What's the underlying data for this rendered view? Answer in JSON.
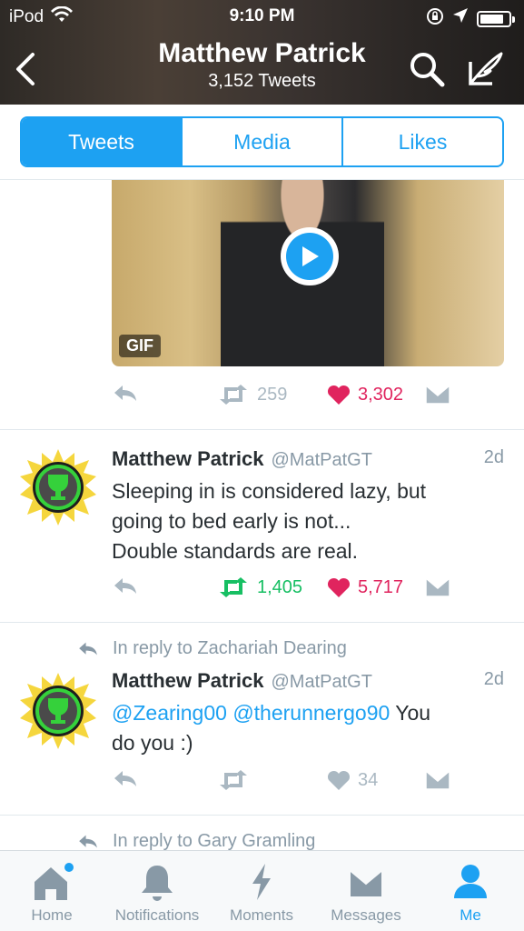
{
  "status": {
    "carrier": "iPod",
    "time": "9:10 PM"
  },
  "profile": {
    "name": "Matthew Patrick",
    "tweet_count": "3,152 Tweets"
  },
  "tabs": [
    {
      "label": "Tweets",
      "active": true
    },
    {
      "label": "Media",
      "active": false
    },
    {
      "label": "Likes",
      "active": false
    }
  ],
  "tweets": [
    {
      "media": {
        "badge": "GIF"
      },
      "retweets": "259",
      "likes": "3,302"
    },
    {
      "name": "Matthew Patrick",
      "handle": "@MatPatGT",
      "time": "2d",
      "text_lines": [
        "Sleeping in is considered lazy, but",
        "going to bed early is not...",
        "Double standards are real."
      ],
      "retweets": "1,405",
      "likes": "5,717"
    },
    {
      "reply_to": "In reply to Zachariah Dearing",
      "name": "Matthew Patrick",
      "handle": "@MatPatGT",
      "time": "2d",
      "mention1": "@Zearing00",
      "mention2": "@therunnergo90",
      "text_tail": "You",
      "text_line2": "do you :)",
      "retweets": "",
      "likes": "34"
    },
    {
      "reply_to": "In reply to Gary Gramling"
    }
  ],
  "tabbar": [
    {
      "label": "Home",
      "icon": "home-icon"
    },
    {
      "label": "Notifications",
      "icon": "bell-icon"
    },
    {
      "label": "Moments",
      "icon": "lightning-icon"
    },
    {
      "label": "Messages",
      "icon": "envelope-icon"
    },
    {
      "label": "Me",
      "icon": "person-icon",
      "active": true
    }
  ],
  "colors": {
    "accent": "#1da1f2",
    "retweet_on": "#17bf63",
    "like_on": "#e0245e",
    "muted": "#8899a6"
  },
  "battery_level": 0.85
}
